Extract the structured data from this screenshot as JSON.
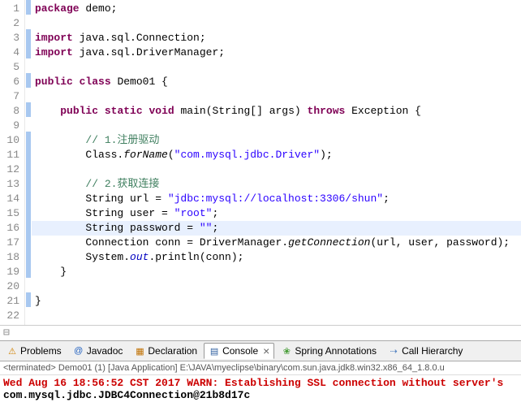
{
  "editor": {
    "lines": [
      {
        "n": 1,
        "cov": true,
        "html": "<span class='kw'>package</span> demo;"
      },
      {
        "n": 2,
        "cov": false,
        "html": ""
      },
      {
        "n": 3,
        "cov": true,
        "html": "<span class='kw'>import</span> java.sql.Connection;"
      },
      {
        "n": 4,
        "cov": true,
        "html": "<span class='kw'>import</span> java.sql.DriverManager;"
      },
      {
        "n": 5,
        "cov": false,
        "html": ""
      },
      {
        "n": 6,
        "cov": true,
        "html": "<span class='kw'>public</span> <span class='kw'>class</span> Demo01 {"
      },
      {
        "n": 7,
        "cov": false,
        "html": ""
      },
      {
        "n": 8,
        "cov": true,
        "html": "    <span class='kw'>public</span> <span class='kw'>static</span> <span class='kw'>void</span> main(String[] args) <span class='kw'>throws</span> Exception {"
      },
      {
        "n": 9,
        "cov": false,
        "html": ""
      },
      {
        "n": 10,
        "cov": true,
        "html": "        <span class='cmt'>// 1.注册驱动</span>"
      },
      {
        "n": 11,
        "cov": true,
        "html": "        Class.<span class='meth'>forName</span>(<span class='str'>\"com.mysql.jdbc.Driver\"</span>);"
      },
      {
        "n": 12,
        "cov": true,
        "html": ""
      },
      {
        "n": 13,
        "cov": true,
        "html": "        <span class='cmt'>// 2.获取连接</span>"
      },
      {
        "n": 14,
        "cov": true,
        "html": "        String url = <span class='str'>\"jdbc:mysql://localhost:3306/shun\"</span>;"
      },
      {
        "n": 15,
        "cov": true,
        "html": "        String user = <span class='str'>\"root\"</span>;"
      },
      {
        "n": 16,
        "cov": true,
        "hl": true,
        "html": "        String password = <span class='str'>\"\"</span>;"
      },
      {
        "n": 17,
        "cov": true,
        "html": "        Connection conn = DriverManager.<span class='meth'>getConnection</span>(url, user, password);"
      },
      {
        "n": 18,
        "cov": true,
        "html": "        System.<span class='field'>out</span>.println(conn);"
      },
      {
        "n": 19,
        "cov": true,
        "html": "    }"
      },
      {
        "n": 20,
        "cov": false,
        "html": ""
      },
      {
        "n": 21,
        "cov": true,
        "html": "}"
      },
      {
        "n": 22,
        "cov": false,
        "html": ""
      }
    ],
    "fold_marker": "⊟"
  },
  "tabs": [
    {
      "id": "problems",
      "icon": "⚠",
      "iconcolor": "#d08000",
      "label": "Problems",
      "active": false
    },
    {
      "id": "javadoc",
      "icon": "@",
      "iconcolor": "#2060c0",
      "label": "Javadoc",
      "active": false
    },
    {
      "id": "declaration",
      "icon": "▦",
      "iconcolor": "#c07000",
      "label": "Declaration",
      "active": false
    },
    {
      "id": "console",
      "icon": "▤",
      "iconcolor": "#3060a0",
      "label": "Console",
      "active": true,
      "closable": true
    },
    {
      "id": "spring",
      "icon": "❀",
      "iconcolor": "#4a9e3a",
      "label": "Spring Annotations",
      "active": false
    },
    {
      "id": "callh",
      "icon": "⇢",
      "iconcolor": "#5080c0",
      "label": "Call Hierarchy",
      "active": false
    }
  ],
  "console": {
    "header": "<terminated> Demo01 (1) [Java Application] E:\\JAVA\\myeclipse\\binary\\com.sun.java.jdk8.win32.x86_64_1.8.0.u",
    "lines": [
      {
        "cls": "warn",
        "text": "Wed Aug 16 18:56:52 CST 2017 WARN: Establishing SSL connection without server's "
      },
      {
        "cls": "out",
        "text": "com.mysql.jdbc.JDBC4Connection@21b8d17c"
      }
    ]
  }
}
